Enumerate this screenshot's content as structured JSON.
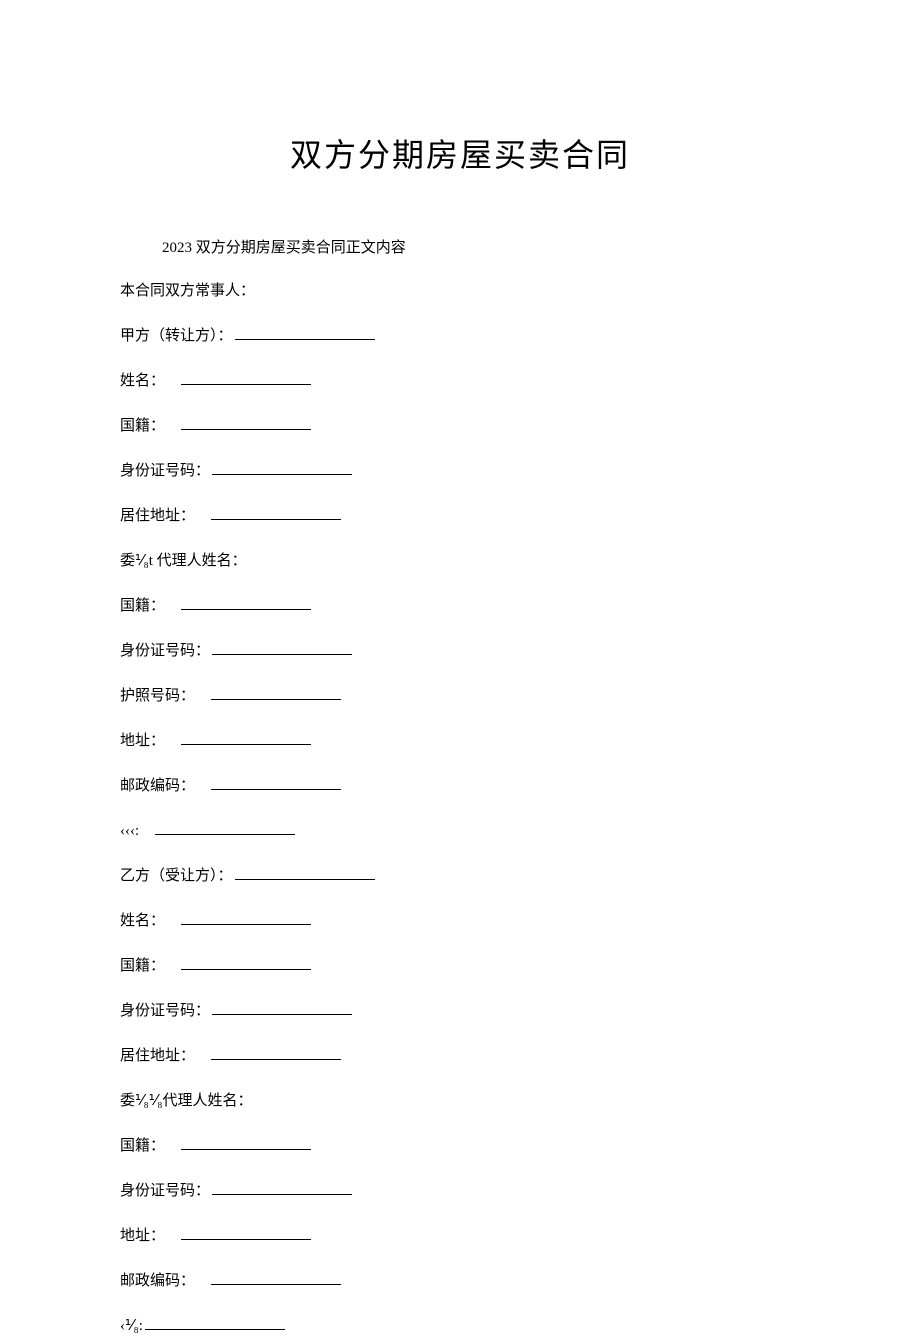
{
  "title": "双方分期房屋买卖合同",
  "subtitle": "2023 双方分期房屋买卖合同正文内容",
  "intro": "本合同双方常事人：",
  "partyA": {
    "header": "甲方（转让方）：",
    "name": "姓名：",
    "nationality": "国籍：",
    "idNumber": "身份证号码：",
    "address": "居住地址：",
    "agentName": "委⅟₈t 代理人姓名：",
    "agentNationality": "国籍：",
    "agentIdNumber": "身份证号码：",
    "passport": "护照号码：",
    "agentAddress": "地址：",
    "postcode": "邮政编码：",
    "phone": "‹‹‹:"
  },
  "partyB": {
    "header": "乙方（受让方）：",
    "name": "姓名：",
    "nationality": "国籍：",
    "idNumber": "身份证号码：",
    "address": "居住地址：",
    "agentName": "委⅟₈⅟₈代理人姓名：",
    "agentNationality": "国籍：",
    "agentIdNumber": "身份证号码：",
    "agentAddress": "地址：",
    "postcode": "邮政编码：",
    "phone": "‹⅟₈:"
  }
}
